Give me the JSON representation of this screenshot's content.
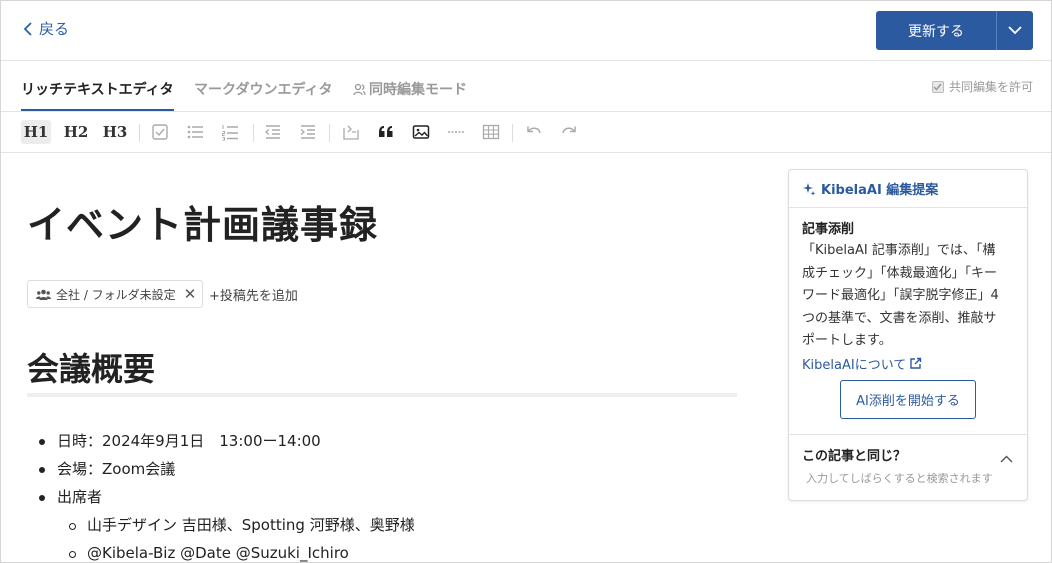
{
  "header": {
    "back_label": "戻る",
    "update_label": "更新する"
  },
  "tabs": [
    {
      "label": "リッチテキストエディタ",
      "active": true
    },
    {
      "label": "マークダウンエディタ",
      "active": false
    },
    {
      "label": "同時編集モード",
      "active": false
    }
  ],
  "collab": {
    "label": "共同編集を許可",
    "checked": true
  },
  "toolbar": {
    "h1": "H1",
    "h2": "H2",
    "h3": "H3",
    "icons": [
      "checkbox-icon",
      "bullet-list-icon",
      "numbered-list-icon",
      "outdent-icon",
      "indent-icon",
      "code-block-icon",
      "quote-icon",
      "image-icon",
      "horizontal-rule-icon",
      "table-icon",
      "undo-icon",
      "redo-icon"
    ]
  },
  "document": {
    "title": "イベント計画議事録",
    "destination_chip": "全社 / フォルダ未設定",
    "add_destination": "+投稿先を追加",
    "section_heading": "会議概要",
    "items": [
      {
        "text": "日時：2024年9月1日　13:00ー14:00",
        "level": 1
      },
      {
        "text": "会場：Zoom会議",
        "level": 1
      },
      {
        "text": "出席者",
        "level": 1
      },
      {
        "text": "山手デザイン 吉田様、Spotting 河野様、奥野様",
        "level": 2
      },
      {
        "text": "@Kibela-Biz @Date @Suzuki_Ichiro",
        "level": 2
      }
    ]
  },
  "ai_panel": {
    "title": "KibelaAI 編集提案",
    "subtitle": "記事添削",
    "description_lines": [
      "「KibelaAI 記事添削」では、「構",
      "成チェック」「体裁最適化」「キー",
      "ワード最適化」「誤字脱字修正」4",
      "つの基準で、文書を添削、推敲サ",
      "ポートします。"
    ],
    "about_link": "KibelaAIについて",
    "start_button": "AI添削を開始する",
    "same_article_heading": "この記事と同じ？",
    "same_article_placeholder": "入力してしばらくすると検索されます"
  },
  "colors": {
    "accent": "#2c5aa0",
    "muted": "#999999"
  }
}
